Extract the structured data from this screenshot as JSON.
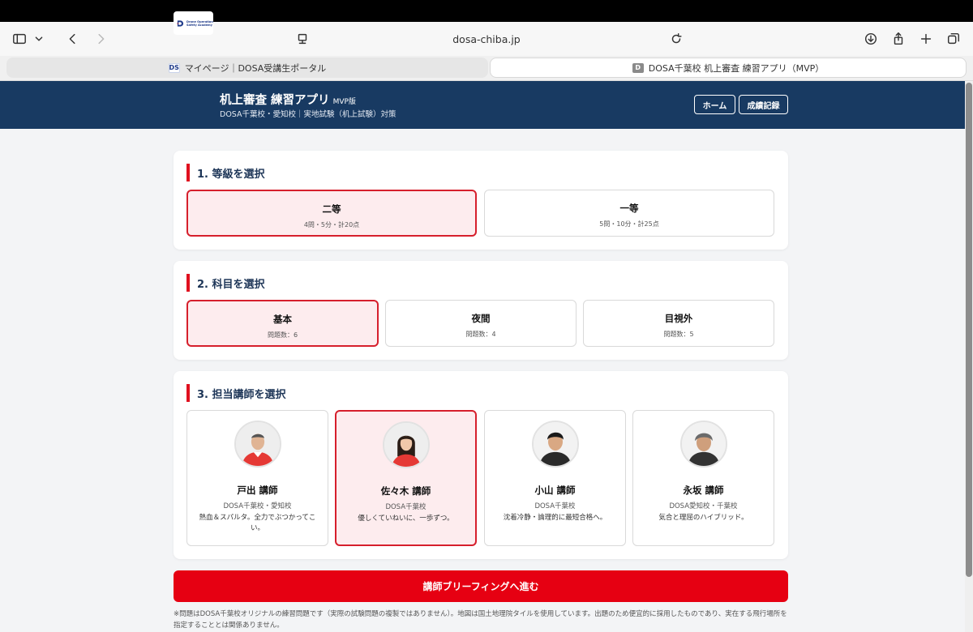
{
  "browser": {
    "url": "dosa-chiba.jp",
    "tabs": [
      {
        "label": "マイページ｜DOSA受講生ポータル",
        "favicon": "DS"
      },
      {
        "label": "DOSA千葉校 机上審査 練習アプリ（MVP）",
        "favicon": "D"
      }
    ]
  },
  "header": {
    "title": "机上審査 練習アプリ",
    "version": "MVP版",
    "subtitle": "DOSA千葉校・愛知校｜実地試験（机上試験）対策",
    "home_label": "ホーム",
    "record_label": "成績記録",
    "logo_text": "Drone Operation Safety Academy"
  },
  "grade": {
    "heading": "1. 等級を選択",
    "options": [
      {
        "name": "二等",
        "meta": "4問・5分・計20点",
        "selected": true
      },
      {
        "name": "一等",
        "meta": "5問・10分・計25点",
        "selected": false
      }
    ]
  },
  "subject": {
    "heading": "2. 科目を選択",
    "options": [
      {
        "name": "基本",
        "meta": "問題数：6",
        "selected": true
      },
      {
        "name": "夜間",
        "meta": "問題数：4",
        "selected": false
      },
      {
        "name": "目視外",
        "meta": "問題数：5",
        "selected": false
      }
    ]
  },
  "instructor": {
    "heading": "3. 担当講師を選択",
    "options": [
      {
        "name": "戸出 講師",
        "school": "DOSA千葉校・愛知校",
        "desc": "熱血＆スパルタ。全力でぶつかってこい。",
        "selected": false
      },
      {
        "name": "佐々木 講師",
        "school": "DOSA千葉校",
        "desc": "優しくていねいに、一歩ずつ。",
        "selected": true
      },
      {
        "name": "小山 講師",
        "school": "DOSA千葉校",
        "desc": "沈着冷静・論理的に最短合格へ。",
        "selected": false
      },
      {
        "name": "永坂 講師",
        "school": "DOSA愛知校・千葉校",
        "desc": "気合と理屈のハイブリッド。",
        "selected": false
      }
    ]
  },
  "cta_label": "講師ブリーフィングへ進む",
  "footnote": "※問題はDOSA千葉校オリジナルの練習問題です（実際の試験問題の複製ではありません）。地図は国土地理院タイルを使用しています。出題のため便宜的に採用したものであり、実在する飛行場所を指定することとは関係ありません。",
  "colors": {
    "header_bg": "#183a62",
    "accent": "#e60012",
    "selected_bg": "#fdecee"
  }
}
